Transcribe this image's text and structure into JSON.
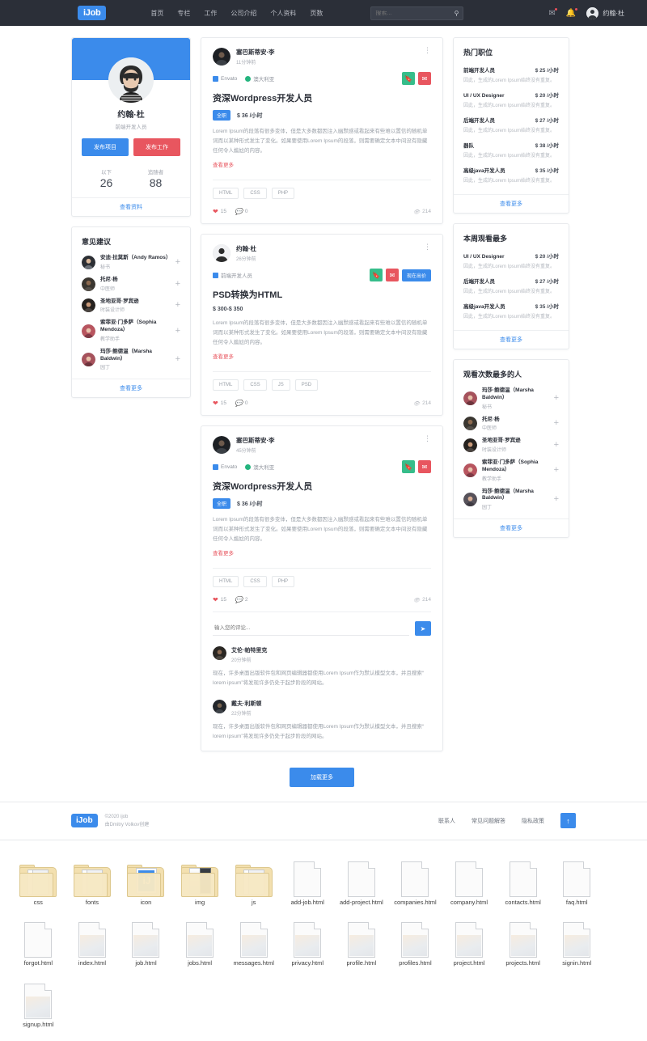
{
  "navbar": {
    "brand": "iJob",
    "links": [
      "首页",
      "专栏",
      "工作",
      "公司介绍",
      "个人资料",
      "页数"
    ],
    "search_placeholder": "搜索...",
    "search_value": "",
    "user_name": "约翰·杜"
  },
  "profile": {
    "name": "约翰·杜",
    "role": "前端开发人员",
    "btn_project": "发布项目",
    "btn_job": "发布工作",
    "stat_following_label": "以下",
    "stat_following_value": "26",
    "stat_followers_label": "追随者",
    "stat_followers_value": "88",
    "more": "查看资料"
  },
  "suggestions": {
    "title": "意见建议",
    "more": "查看更多",
    "items": [
      {
        "name": "安迪·拉莫斯（Andy Ramos）",
        "role": "秘书"
      },
      {
        "name": "托尼·杨",
        "role": "中医师"
      },
      {
        "name": "圣地亚哥·罗宾逊",
        "role": "时装设计师"
      },
      {
        "name": "索菲亚·门多萨（Sophia Mendoza）",
        "role": "教学助手"
      },
      {
        "name": "玛莎·鲍德温（Marsha Baldwin）",
        "role": "园丁"
      }
    ]
  },
  "posts": [
    {
      "author": "塞巴斯蒂安·李",
      "time": "11分钟前",
      "company": "Envato",
      "location": "澳大利亚",
      "title": "资深Wordpress开发人员",
      "badge": "全职",
      "price": "$ 36 /小时",
      "text": "Lorem Ipsum的段落有很多变体，但是大多数都因注入幽默感或看起来有些难以置信的随机单词而以某种形式发生了变化。如果要使用Lorem Ipsum的段落，则需要确定文本中间没有隐藏任何令人尴尬的内容。",
      "read_more": "查看更多",
      "tags": [
        "HTML",
        "CSS",
        "PHP"
      ],
      "likes": "15",
      "comments": "0",
      "views": "214",
      "has_bid": false,
      "has_comments_section": false
    },
    {
      "author": "约翰·杜",
      "time": "26分钟前",
      "company": "前端开发人员",
      "location": "",
      "title": "PSD转换为HTML",
      "badge": "",
      "price": "$ 300-$ 350",
      "text": "Lorem Ipsum的段落有很多变体，但是大多数都因注入幽默感或看起来有些难以置信的随机单词而以某种形式发生了变化。如果要使用Lorem Ipsum的段落，则需要确定文本中间没有隐藏任何令人尴尬的内容。",
      "read_more": "查看更多",
      "tags": [
        "HTML",
        "CSS",
        "JS",
        "PSD"
      ],
      "likes": "15",
      "comments": "0",
      "views": "214",
      "has_bid": true,
      "bid_label": "现在出价",
      "has_comments_section": false
    },
    {
      "author": "塞巴斯蒂安·李",
      "time": "45分钟前",
      "company": "Envato",
      "location": "澳大利亚",
      "title": "资深Wordpress开发人员",
      "badge": "全职",
      "price": "$ 36 /小时",
      "text": "Lorem Ipsum的段落有很多变体，但是大多数都因注入幽默感或看起来有些难以置信的随机单词而以某种形式发生了变化。如果要使用Lorem Ipsum的段落，则需要确定文本中间没有隐藏任何令人尴尬的内容。",
      "read_more": "查看更多",
      "tags": [
        "HTML",
        "CSS",
        "PHP"
      ],
      "likes": "15",
      "comments": "2",
      "views": "214",
      "has_bid": false,
      "has_comments_section": true
    }
  ],
  "comment_box": {
    "placeholder": "输入您的评论...",
    "value": ""
  },
  "comments": [
    {
      "author": "艾伦·帕特里克",
      "time": "20分钟前",
      "text": "现在，许多桌面出版软件包和网页编辑器都使用Lorem Ipsum作为默认模型文本，并且搜索“ lorem ipsum”将发现许多仍处于起步阶段的网站。"
    },
    {
      "author": "戴夫·利斯顿",
      "time": "22分钟前",
      "text": "现在，许多桌面出版软件包和网页编辑器都使用Lorem Ipsum作为默认模型文本，并且搜索“ lorem ipsum”将发现许多仍处于起步阶段的网站。"
    }
  ],
  "hot_jobs": {
    "title": "热门职位",
    "more": "查看更多",
    "items": [
      {
        "name": "前端开发人员",
        "price": "$ 25 /小时",
        "desc": "因此，生成的Lorem Ipsum始终没有重复。"
      },
      {
        "name": "UI / UX Designer",
        "price": "$ 20 /小时",
        "desc": "因此，生成的Lorem Ipsum始终没有重复。"
      },
      {
        "name": "后端开发人员",
        "price": "$ 27 /小时",
        "desc": "因此，生成的Lorem Ipsum始终没有重复。"
      },
      {
        "name": "器队",
        "price": "$ 38 /小时",
        "desc": "因此，生成的Lorem Ipsum始终没有重复。"
      },
      {
        "name": "高级java开发人员",
        "price": "$ 35 /小时",
        "desc": "因此，生成的Lorem Ipsum始终没有重复。"
      }
    ]
  },
  "most_viewed": {
    "title": "本周观看最多",
    "more": "查看更多",
    "items": [
      {
        "name": "UI / UX Designer",
        "price": "$ 20 /小时",
        "desc": "因此，生成的Lorem Ipsum始终没有重复。"
      },
      {
        "name": "后端开发人员",
        "price": "$ 27 /小时",
        "desc": "因此，生成的Lorem Ipsum始终没有重复。"
      },
      {
        "name": "高级java开发人员",
        "price": "$ 35 /小时",
        "desc": "因此，生成的Lorem Ipsum始终没有重复。"
      }
    ]
  },
  "most_viewed_people": {
    "title": "观看次数最多的人",
    "more": "查看更多",
    "items": [
      {
        "name": "玛莎·鲍德温（Marsha Baldwin）",
        "role": "秘书"
      },
      {
        "name": "托尼·杨",
        "role": "中医师"
      },
      {
        "name": "圣地亚哥·罗宾逊",
        "role": "时装设计师"
      },
      {
        "name": "索菲亚·门多萨（Sophia Mendoza）",
        "role": "教学助手"
      },
      {
        "name": "玛莎·鲍德温（Marsha Baldwin）",
        "role": "园丁"
      }
    ]
  },
  "load_more_label": "加载更多",
  "footer": {
    "brand": "iJob",
    "copy_line1": "©2020 ijob",
    "copy_line2": "由Dmitry Volkov创建",
    "links": [
      "联系人",
      "常见问题解答",
      "隐私政策"
    ]
  },
  "files": [
    {
      "name": "css",
      "type": "folder-docs"
    },
    {
      "name": "fonts",
      "type": "folder-docs"
    },
    {
      "name": "icon",
      "type": "folder-icon"
    },
    {
      "name": "img",
      "type": "folder-img"
    },
    {
      "name": "js",
      "type": "folder-docs"
    },
    {
      "name": "add-job.html",
      "type": "doc-plain"
    },
    {
      "name": "add-project.html",
      "type": "doc-plain"
    },
    {
      "name": "companies.html",
      "type": "doc-plain"
    },
    {
      "name": "company.html",
      "type": "doc-plain"
    },
    {
      "name": "contacts.html",
      "type": "doc-plain"
    },
    {
      "name": "faq.html",
      "type": "doc-plain"
    },
    {
      "name": "forgot.html",
      "type": "doc-plain"
    },
    {
      "name": "index.html",
      "type": "doc-pic"
    },
    {
      "name": "job.html",
      "type": "doc-pic"
    },
    {
      "name": "jobs.html",
      "type": "doc-pic"
    },
    {
      "name": "messages.html",
      "type": "doc-pic"
    },
    {
      "name": "privacy.html",
      "type": "doc-pic"
    },
    {
      "name": "profile.html",
      "type": "doc-pic"
    },
    {
      "name": "profiles.html",
      "type": "doc-pic"
    },
    {
      "name": "project.html",
      "type": "doc-pic"
    },
    {
      "name": "projects.html",
      "type": "doc-pic"
    },
    {
      "name": "signin.html",
      "type": "doc-pic"
    },
    {
      "name": "signup.html",
      "type": "doc-pic"
    }
  ],
  "colors": {
    "accent": "#3b8beb",
    "danger": "#e8565f",
    "success": "#36bd8a",
    "navbar": "#2b2f38"
  }
}
